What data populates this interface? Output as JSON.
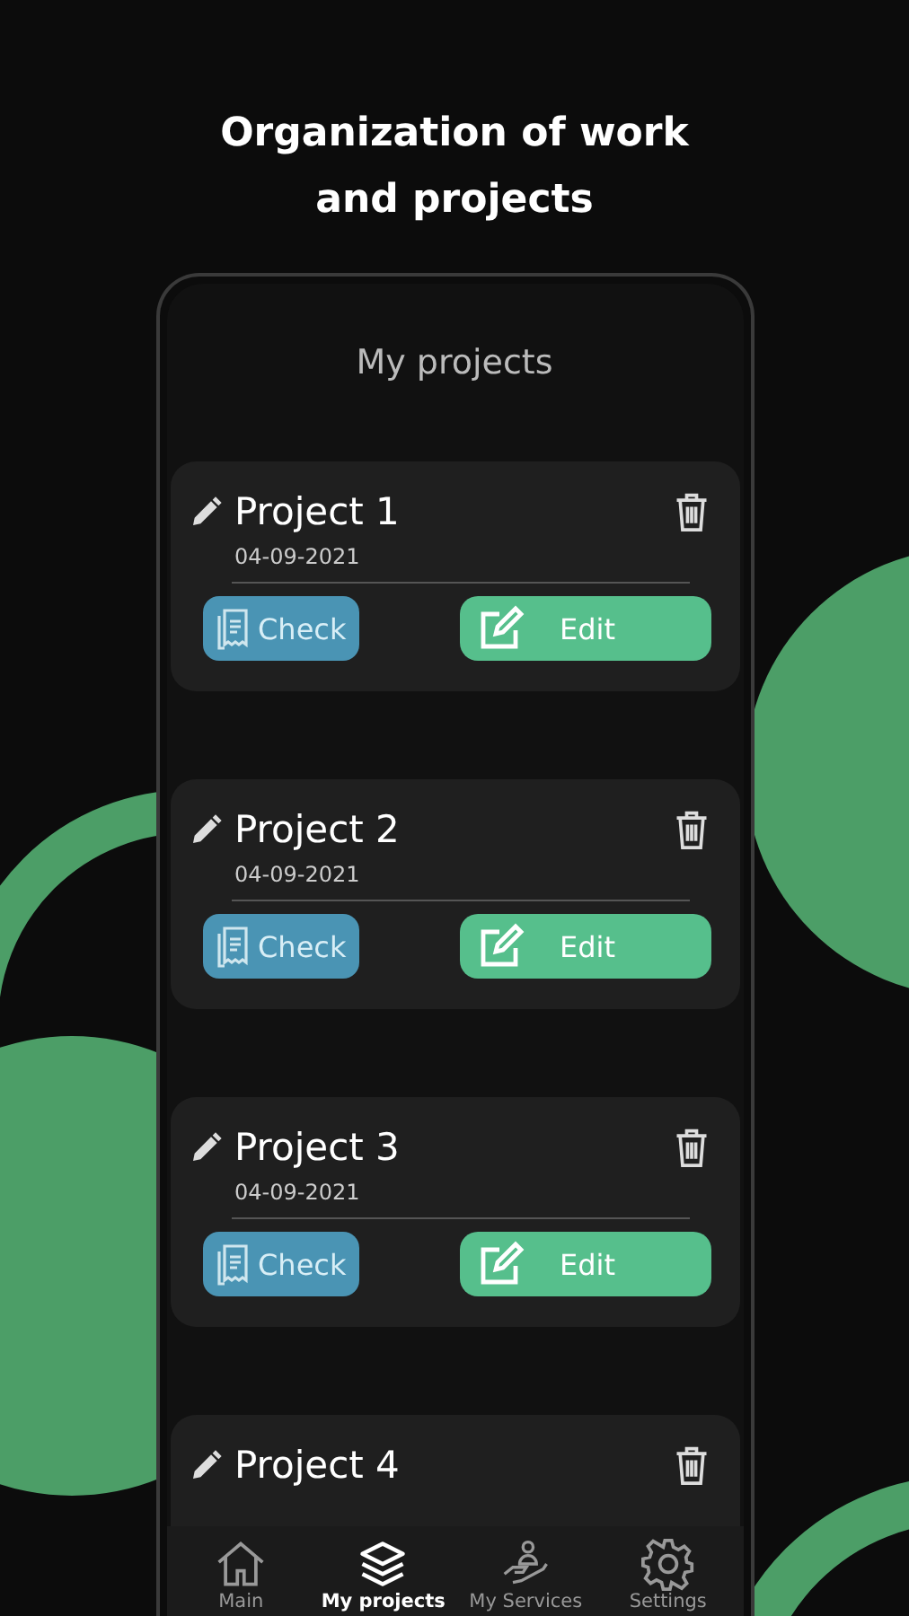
{
  "headline": "Organization of work\nand projects",
  "screen_title": "My projects",
  "projects": [
    {
      "title": "Project 1",
      "date": "04-09-2021",
      "check": "Check",
      "edit": "Edit"
    },
    {
      "title": "Project 2",
      "date": "04-09-2021",
      "check": "Check",
      "edit": "Edit"
    },
    {
      "title": "Project 3",
      "date": "04-09-2021",
      "check": "Check",
      "edit": "Edit"
    },
    {
      "title": "Project 4"
    }
  ],
  "nav": [
    {
      "kind": "home",
      "label": "Main",
      "selected": false
    },
    {
      "kind": "layers",
      "label": "My projects",
      "selected": true
    },
    {
      "kind": "services",
      "label": "My Services",
      "selected": false
    },
    {
      "kind": "settings",
      "label": "Settings",
      "selected": false
    }
  ]
}
